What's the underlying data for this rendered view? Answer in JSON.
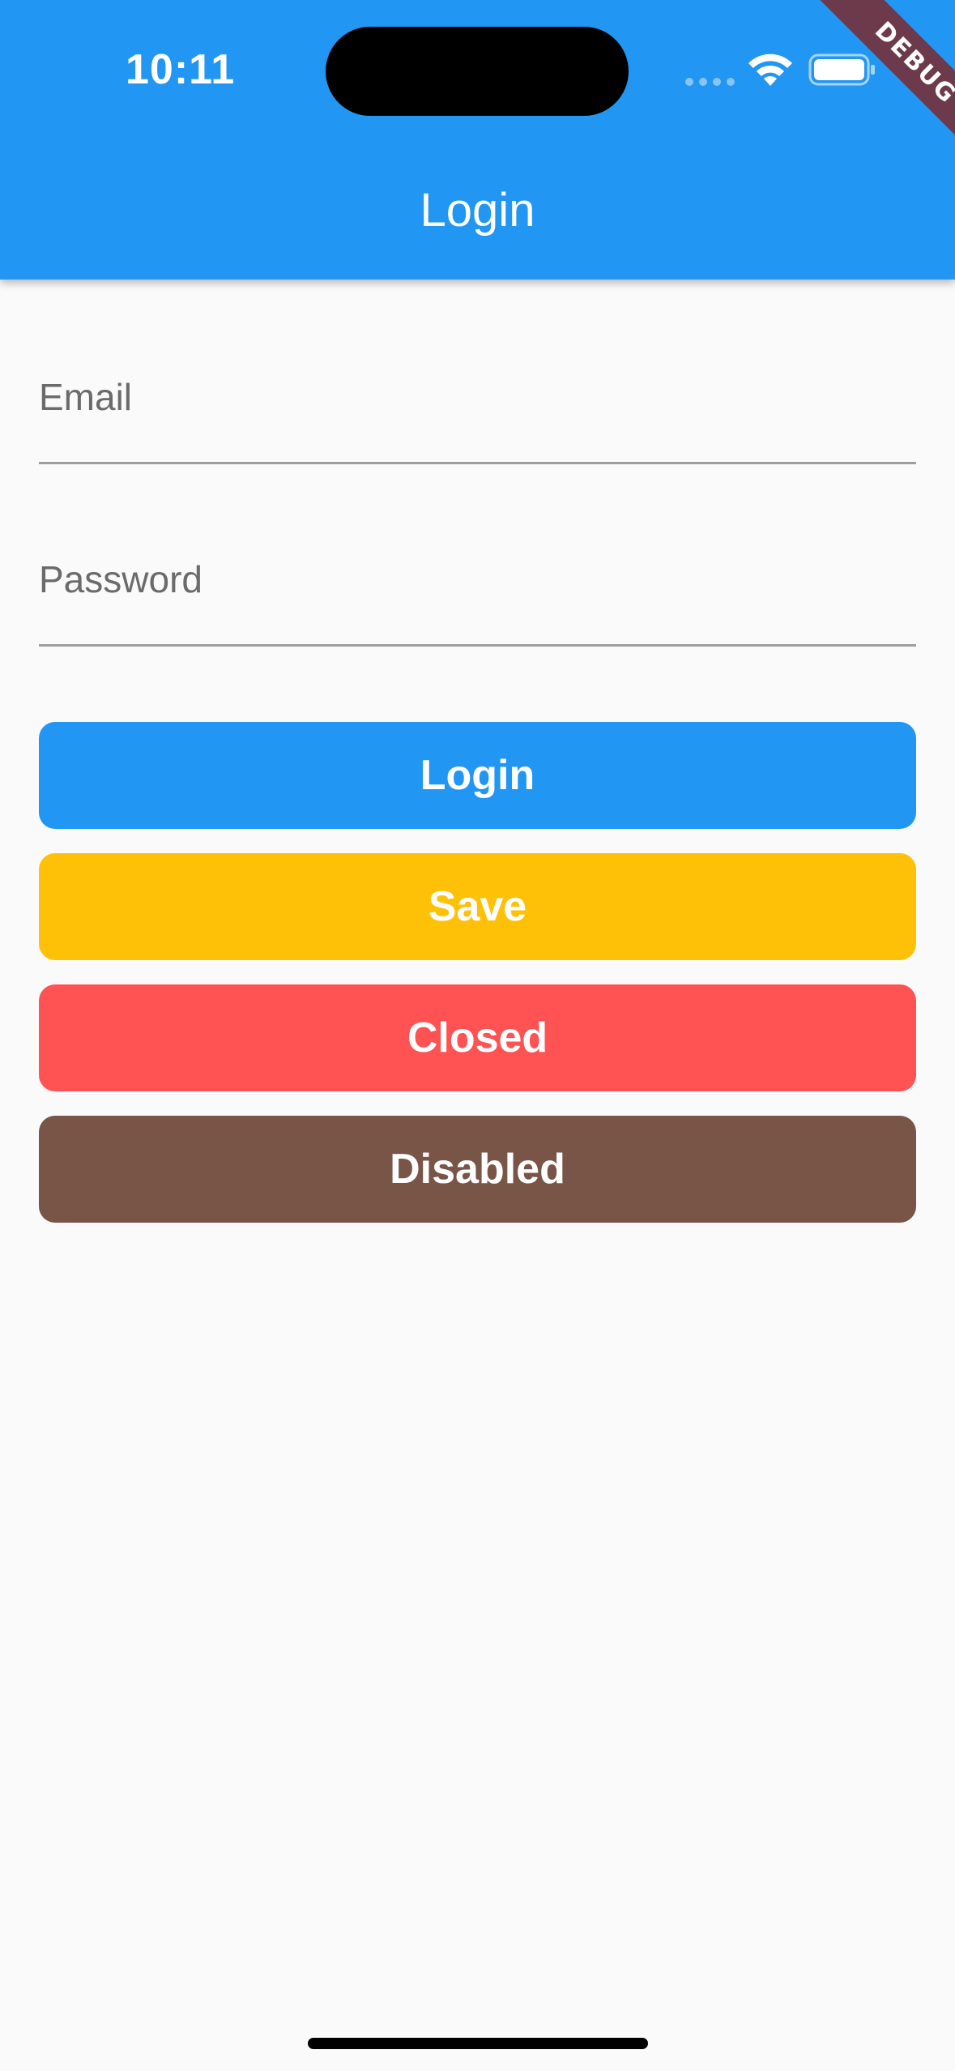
{
  "status_bar": {
    "time": "10:11",
    "icons": [
      "cellular-dots-icon",
      "wifi-icon",
      "battery-icon"
    ]
  },
  "debug_banner": {
    "label": "DEBUG",
    "color": "#6D3A4C"
  },
  "app_bar": {
    "title": "Login",
    "color": "#2196F3"
  },
  "form": {
    "email": {
      "label": "Email",
      "value": ""
    },
    "password": {
      "label": "Password",
      "value": ""
    }
  },
  "buttons": {
    "login": {
      "label": "Login",
      "color": "#2196F3"
    },
    "save": {
      "label": "Save",
      "color": "#FFC107"
    },
    "closed": {
      "label": "Closed",
      "color": "#FF5252"
    },
    "disabled": {
      "label": "Disabled",
      "color": "#795548"
    }
  }
}
